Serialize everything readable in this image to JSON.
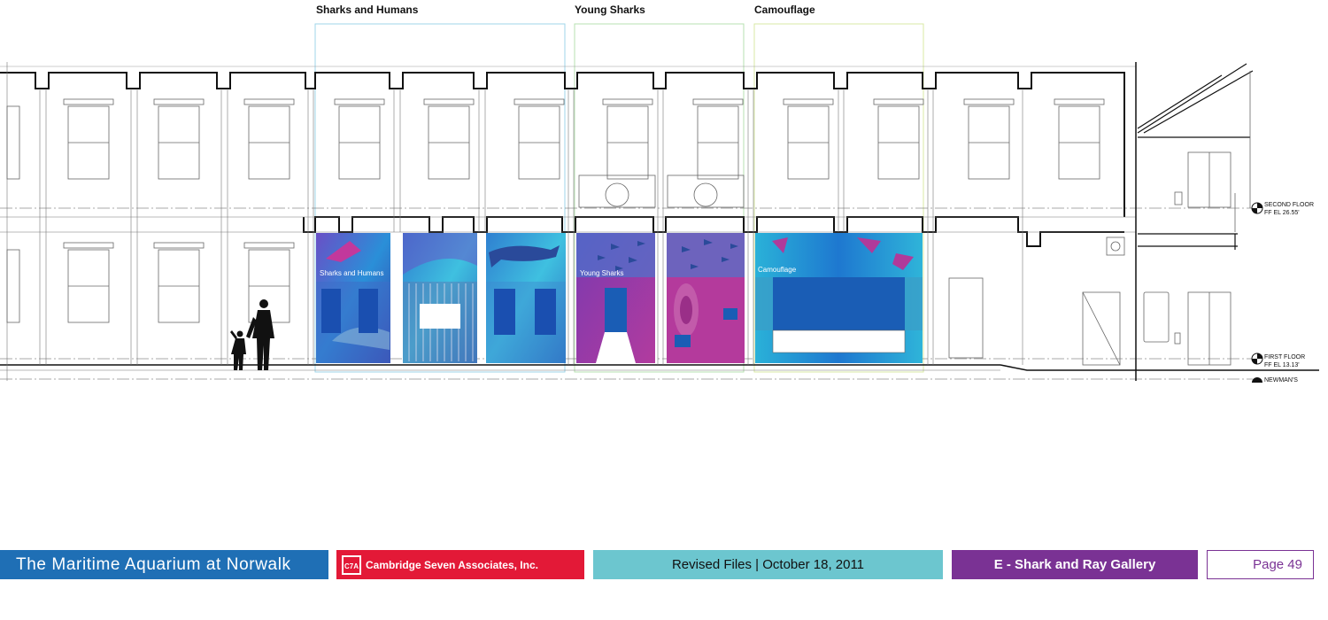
{
  "sections": {
    "sharks_humans": "Sharks and Humans",
    "young_sharks": "Young Sharks",
    "camouflage": "Camouflage"
  },
  "panels": {
    "sharks_humans": "Sharks and Humans",
    "young_sharks": "Young Sharks",
    "camouflage": "Camouflage"
  },
  "levels": {
    "second_floor": "SECOND FLOOR",
    "second_el": "FF EL 26.55'",
    "first_floor": "FIRST FLOOR",
    "first_el": "FF EL 13.13'",
    "newmans": "NEWMAN'S"
  },
  "footer": {
    "client": "The Maritime Aquarium at Norwalk",
    "firm": "Cambridge Seven Associates, Inc.",
    "firm_logo_text": "C7A",
    "revision": "Revised Files | October 18, 2011",
    "gallery": "E - Shark and Ray Gallery",
    "page": "Page 49"
  },
  "colors": {
    "aquarium_blue": "#1f6fb5",
    "firm_red": "#e31937",
    "revision_teal": "#6cc6cf",
    "gallery_purple": "#7a3294",
    "exhibit_blue": "#1a5db5",
    "exhibit_magenta": "#b03a9a",
    "exhibit_cyan": "#2fb4d9"
  }
}
